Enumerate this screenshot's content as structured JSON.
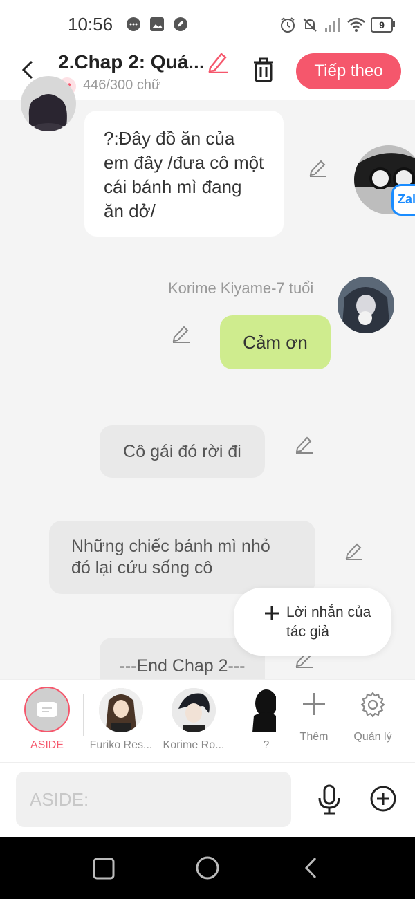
{
  "status_bar": {
    "time": "10:56",
    "battery": "9"
  },
  "header": {
    "title": "2.Chap 2: Quá...",
    "word_count": "446/300 chữ",
    "next_button": "Tiếp theo",
    "accent_color": "#f5576c"
  },
  "messages": [
    {
      "type": "character-left",
      "text": "?:Đây đồ ăn của em đây /đưa cô một cái bánh mì đang ăn dở/"
    },
    {
      "type": "character-right",
      "name": "Korime Kiyame-7 tuổi",
      "text": "Cảm ơn"
    },
    {
      "type": "aside",
      "text": "Cô gái đó rời đi"
    },
    {
      "type": "aside",
      "text": "Những chiếc bánh mì nhỏ đó lại cứu sống cô"
    },
    {
      "type": "aside",
      "text": "---End Chap 2---"
    }
  ],
  "floating_badge": "Zal",
  "author_note_button": "Lời nhắn của tác giả",
  "character_bar": {
    "items": [
      {
        "label": "ASIDE",
        "icon": "aside-icon"
      },
      {
        "label": "Furiko Res...",
        "icon": "avatar"
      },
      {
        "label": "Korime Ro...",
        "icon": "avatar"
      },
      {
        "label": "?",
        "icon": "silhouette"
      },
      {
        "label": "Thêm",
        "icon": "plus-icon"
      },
      {
        "label": "Quản lý",
        "icon": "gear-icon"
      }
    ],
    "active_color": "#f5576c"
  },
  "input": {
    "placeholder": "ASIDE:"
  }
}
